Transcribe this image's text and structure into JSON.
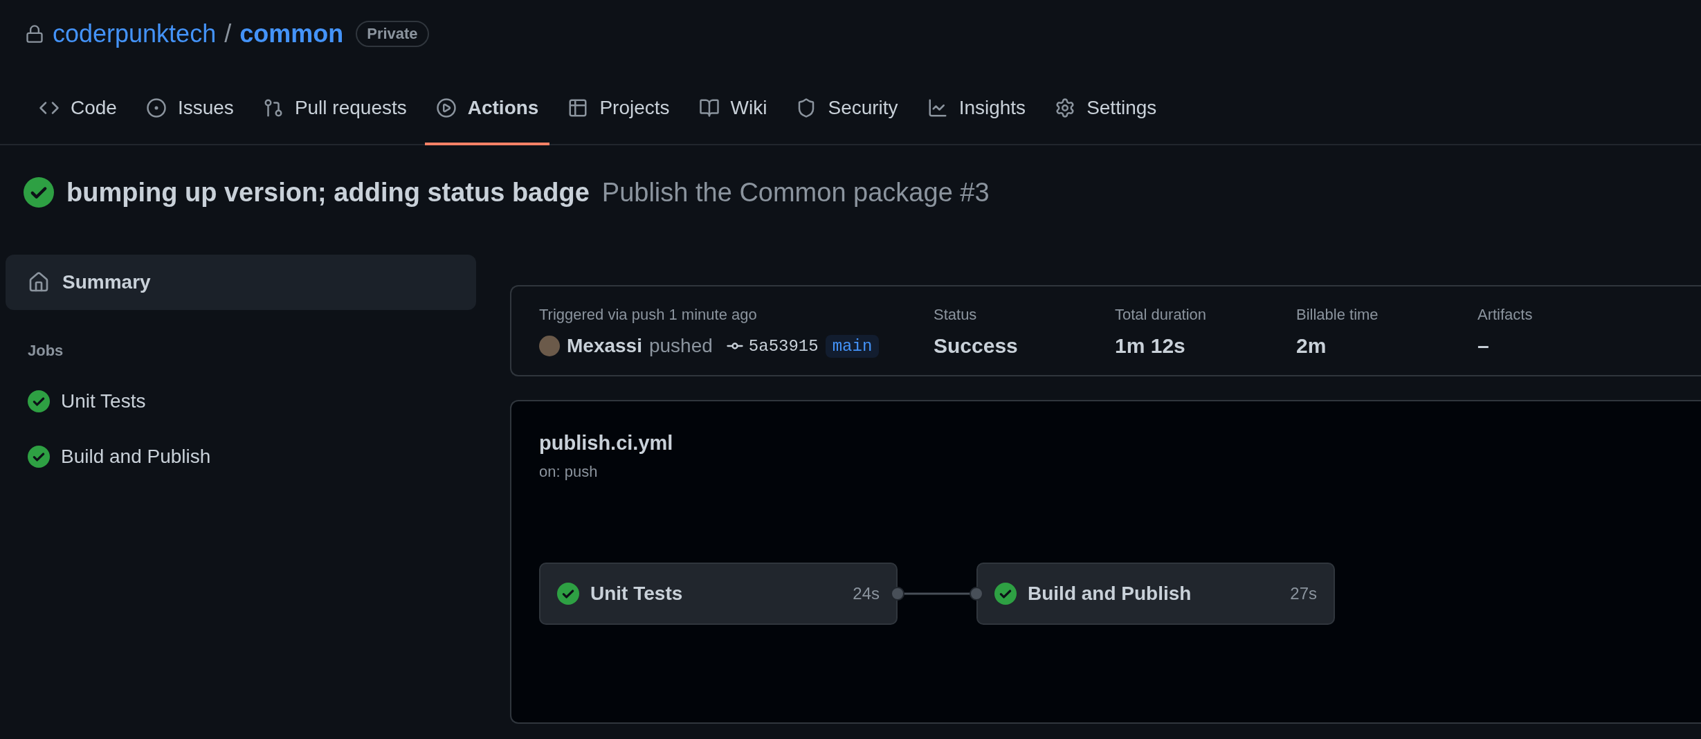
{
  "repo": {
    "owner": "coderpunktech",
    "separator": "/",
    "name": "common",
    "visibility": "Private"
  },
  "tabs": [
    {
      "label": "Code",
      "selected": false
    },
    {
      "label": "Issues",
      "selected": false
    },
    {
      "label": "Pull requests",
      "selected": false
    },
    {
      "label": "Actions",
      "selected": true
    },
    {
      "label": "Projects",
      "selected": false
    },
    {
      "label": "Wiki",
      "selected": false
    },
    {
      "label": "Security",
      "selected": false
    },
    {
      "label": "Insights",
      "selected": false
    },
    {
      "label": "Settings",
      "selected": false
    }
  ],
  "run": {
    "kind": "success",
    "commit_message": "bumping up version; adding status badge",
    "workflow": "Publish the Common package #3"
  },
  "sidebar": {
    "summary": {
      "label": "Summary",
      "selected": true
    },
    "jobs_heading": "Jobs",
    "jobs": [
      {
        "label": "Unit Tests",
        "kind": "success"
      },
      {
        "label": "Build and Publish",
        "kind": "success"
      }
    ]
  },
  "summary": {
    "trigger": "Triggered via push 1 minute ago",
    "actor": "Mexassi",
    "action": "pushed",
    "commit": "5a53915",
    "branch": "main",
    "stats": [
      {
        "label": "Status",
        "value": "Success"
      },
      {
        "label": "Total duration",
        "value": "1m 12s"
      },
      {
        "label": "Billable time",
        "value": "2m"
      },
      {
        "label": "Artifacts",
        "value": "–"
      }
    ]
  },
  "workflow": {
    "file": "publish.ci.yml",
    "trigger": "on: push",
    "jobs": [
      {
        "label": "Unit Tests",
        "duration": "24s",
        "kind": "success"
      },
      {
        "label": "Build and Publish",
        "duration": "27s",
        "kind": "success"
      }
    ]
  }
}
